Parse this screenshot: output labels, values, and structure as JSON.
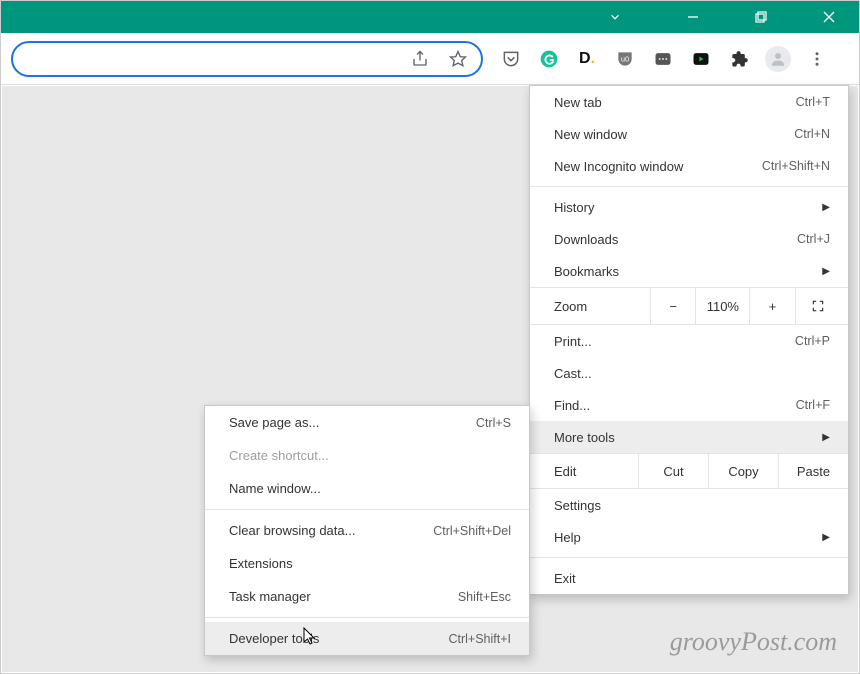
{
  "titlebar": {
    "accent": "#00967d"
  },
  "toolbar": {
    "extensions": [
      {
        "name": "pocket"
      },
      {
        "name": "grammarly"
      },
      {
        "name": "ext-d"
      },
      {
        "name": "ublock"
      },
      {
        "name": "ext-slides"
      },
      {
        "name": "ext-media"
      },
      {
        "name": "extensions-puzzle"
      }
    ]
  },
  "menu": {
    "new_tab": {
      "label": "New tab",
      "shortcut": "Ctrl+T"
    },
    "new_window": {
      "label": "New window",
      "shortcut": "Ctrl+N"
    },
    "new_incognito": {
      "label": "New Incognito window",
      "shortcut": "Ctrl+Shift+N"
    },
    "history": {
      "label": "History"
    },
    "downloads": {
      "label": "Downloads",
      "shortcut": "Ctrl+J"
    },
    "bookmarks": {
      "label": "Bookmarks"
    },
    "zoom": {
      "label": "Zoom",
      "value": "110%",
      "minus": "−",
      "plus": "+"
    },
    "print": {
      "label": "Print...",
      "shortcut": "Ctrl+P"
    },
    "cast": {
      "label": "Cast..."
    },
    "find": {
      "label": "Find...",
      "shortcut": "Ctrl+F"
    },
    "more_tools": {
      "label": "More tools"
    },
    "edit": {
      "label": "Edit",
      "cut": "Cut",
      "copy": "Copy",
      "paste": "Paste"
    },
    "settings": {
      "label": "Settings"
    },
    "help": {
      "label": "Help"
    },
    "exit": {
      "label": "Exit"
    }
  },
  "submenu": {
    "save_page": {
      "label": "Save page as...",
      "shortcut": "Ctrl+S"
    },
    "create_shortcut": {
      "label": "Create shortcut..."
    },
    "name_window": {
      "label": "Name window..."
    },
    "clear_browsing": {
      "label": "Clear browsing data...",
      "shortcut": "Ctrl+Shift+Del"
    },
    "extensions": {
      "label": "Extensions"
    },
    "task_manager": {
      "label": "Task manager",
      "shortcut": "Shift+Esc"
    },
    "dev_tools": {
      "label": "Developer tools",
      "shortcut": "Ctrl+Shift+I"
    }
  },
  "watermark": "groovyPost.com"
}
